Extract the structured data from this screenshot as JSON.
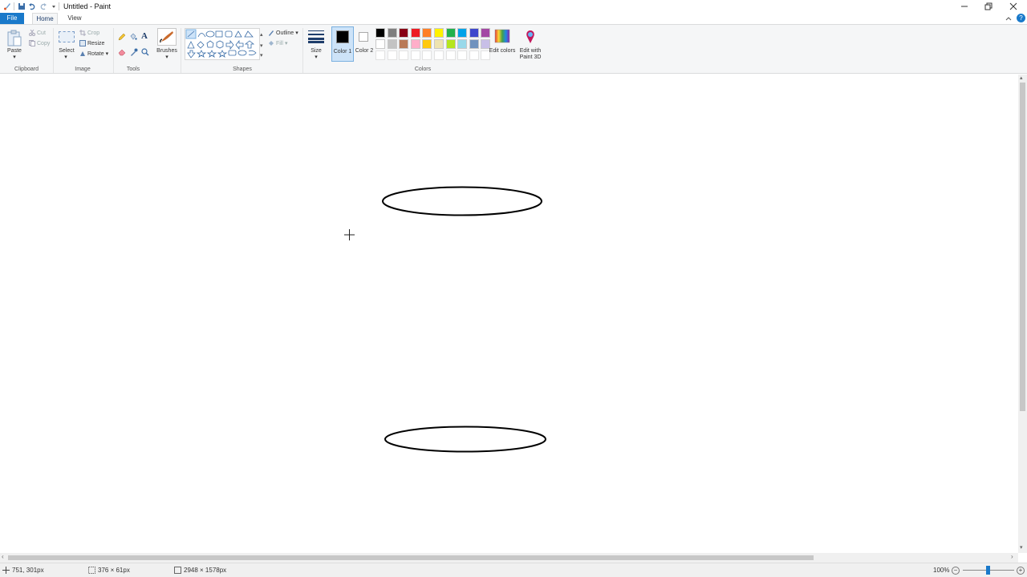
{
  "window": {
    "title": "Untitled - Paint"
  },
  "tabs": {
    "file": "File",
    "home": "Home",
    "view": "View"
  },
  "ribbon": {
    "clipboard": {
      "paste": "Paste",
      "cut": "Cut",
      "copy": "Copy",
      "group": "Clipboard"
    },
    "image": {
      "select": "Select",
      "crop": "Crop",
      "resize": "Resize",
      "rotate": "Rotate",
      "group": "Image"
    },
    "tools": {
      "group": "Tools",
      "brushes": "Brushes"
    },
    "shapes": {
      "outline": "Outline",
      "fill": "Fill",
      "group": "Shapes"
    },
    "size": "Size",
    "color1": "Color 1",
    "color2": "Color 2",
    "colors_group": "Colors",
    "edit_colors": "Edit colors",
    "edit_3d": "Edit with Paint 3D"
  },
  "palette": {
    "row1": [
      "#000000",
      "#7f7f7f",
      "#880015",
      "#ed1c24",
      "#ff7f27",
      "#fff200",
      "#22b14c",
      "#00a2e8",
      "#3f48cc",
      "#a349a4"
    ],
    "row2": [
      "#ffffff",
      "#c3c3c3",
      "#b97a57",
      "#ffaec9",
      "#ffc90e",
      "#efe4b0",
      "#b5e61d",
      "#99d9ea",
      "#7092be",
      "#c8bfe7"
    ],
    "color1": "#000000",
    "color2": "#ffffff"
  },
  "status": {
    "cursor": "751, 301px",
    "selection": "376 × 61px",
    "canvas_size": "2948 × 1578px",
    "zoom": "100%"
  }
}
